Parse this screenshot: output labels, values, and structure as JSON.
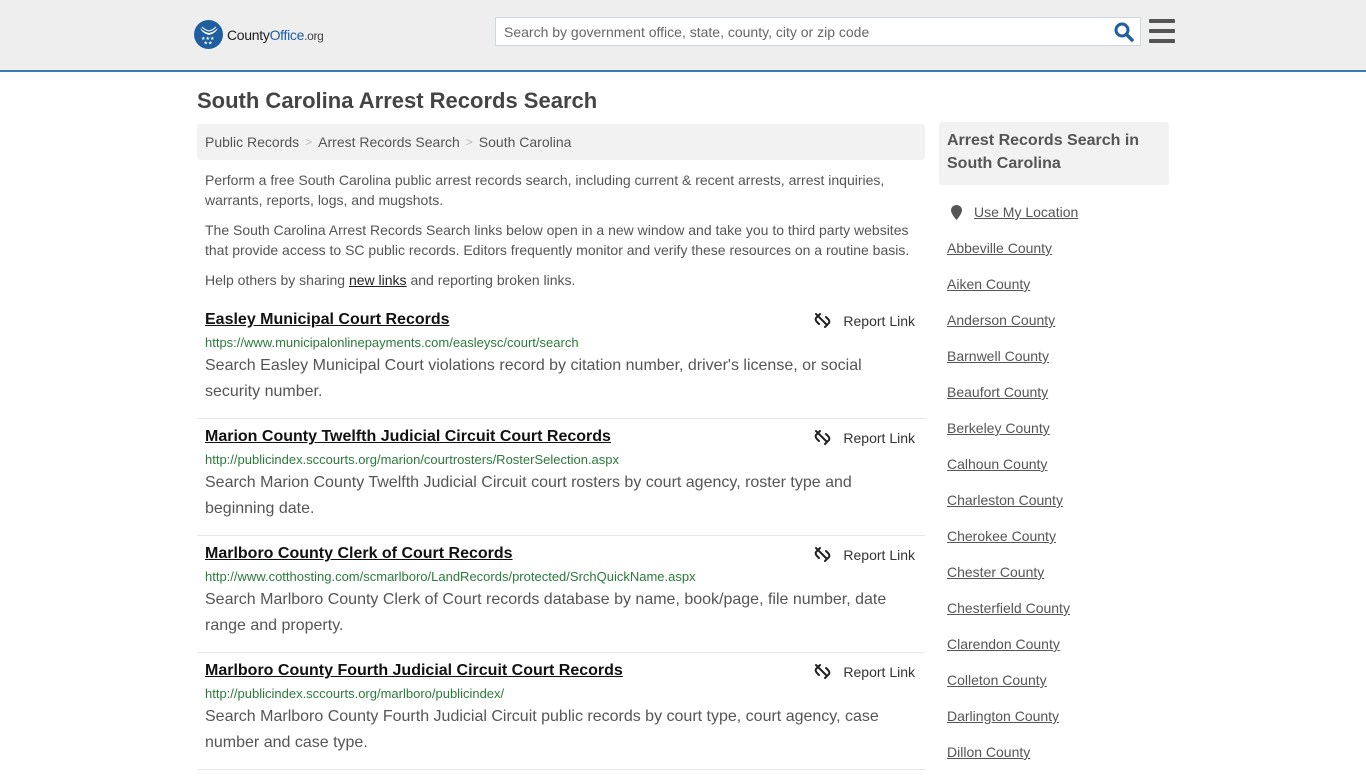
{
  "header": {
    "logo": {
      "name_part1": "County",
      "name_part2": "Office",
      "tld": ".org"
    },
    "search": {
      "placeholder": "Search by government office, state, county, city or zip code",
      "value": ""
    },
    "colors": {
      "brand": "#1f5fa0",
      "header_bg": "#eeeeee",
      "accent_line": "#3a7bb0"
    }
  },
  "page": {
    "title": "South Carolina Arrest Records Search",
    "breadcrumb": [
      {
        "label": "Public Records"
      },
      {
        "label": "Arrest Records Search"
      },
      {
        "label": "South Carolina"
      }
    ],
    "intro": {
      "p1": "Perform a free South Carolina public arrest records search, including current & recent arrests, arrest inquiries, warrants, reports, logs, and mugshots.",
      "p2": "The South Carolina Arrest Records Search links below open in a new window and take you to third party websites that provide access to SC public records. Editors frequently monitor and verify these resources on a routine basis.",
      "p3_before": "Help others by sharing ",
      "p3_link": "new links",
      "p3_after": " and reporting broken links."
    }
  },
  "results": [
    {
      "title": "Easley Municipal Court Records",
      "url": "https://www.municipalonlinepayments.com/easleysc/court/search",
      "description": "Search Easley Municipal Court violations record by citation number, driver's license, or social security number.",
      "report_label": "Report Link"
    },
    {
      "title": "Marion County Twelfth Judicial Circuit Court Records",
      "url": "http://publicindex.sccourts.org/marion/courtrosters/RosterSelection.aspx",
      "description": "Search Marion County Twelfth Judicial Circuit court rosters by court agency, roster type and beginning date.",
      "report_label": "Report Link"
    },
    {
      "title": "Marlboro County Clerk of Court Records",
      "url": "http://www.cotthosting.com/scmarlboro/LandRecords/protected/SrchQuickName.aspx",
      "description": "Search Marlboro County Clerk of Court records database by name, book/page, file number, date range and property.",
      "report_label": "Report Link"
    },
    {
      "title": "Marlboro County Fourth Judicial Circuit Court Records",
      "url": "http://publicindex.sccourts.org/marlboro/publicindex/",
      "description": "Search Marlboro County Fourth Judicial Circuit public records by court type, court agency, case number and case type.",
      "report_label": "Report Link"
    }
  ],
  "sidebar": {
    "heading": "Arrest Records Search in South Carolina",
    "use_location": "Use My Location",
    "counties": [
      "Abbeville County",
      "Aiken County",
      "Anderson County",
      "Barnwell County",
      "Beaufort County",
      "Berkeley County",
      "Calhoun County",
      "Charleston County",
      "Cherokee County",
      "Chester County",
      "Chesterfield County",
      "Clarendon County",
      "Colleton County",
      "Darlington County",
      "Dillon County"
    ]
  }
}
